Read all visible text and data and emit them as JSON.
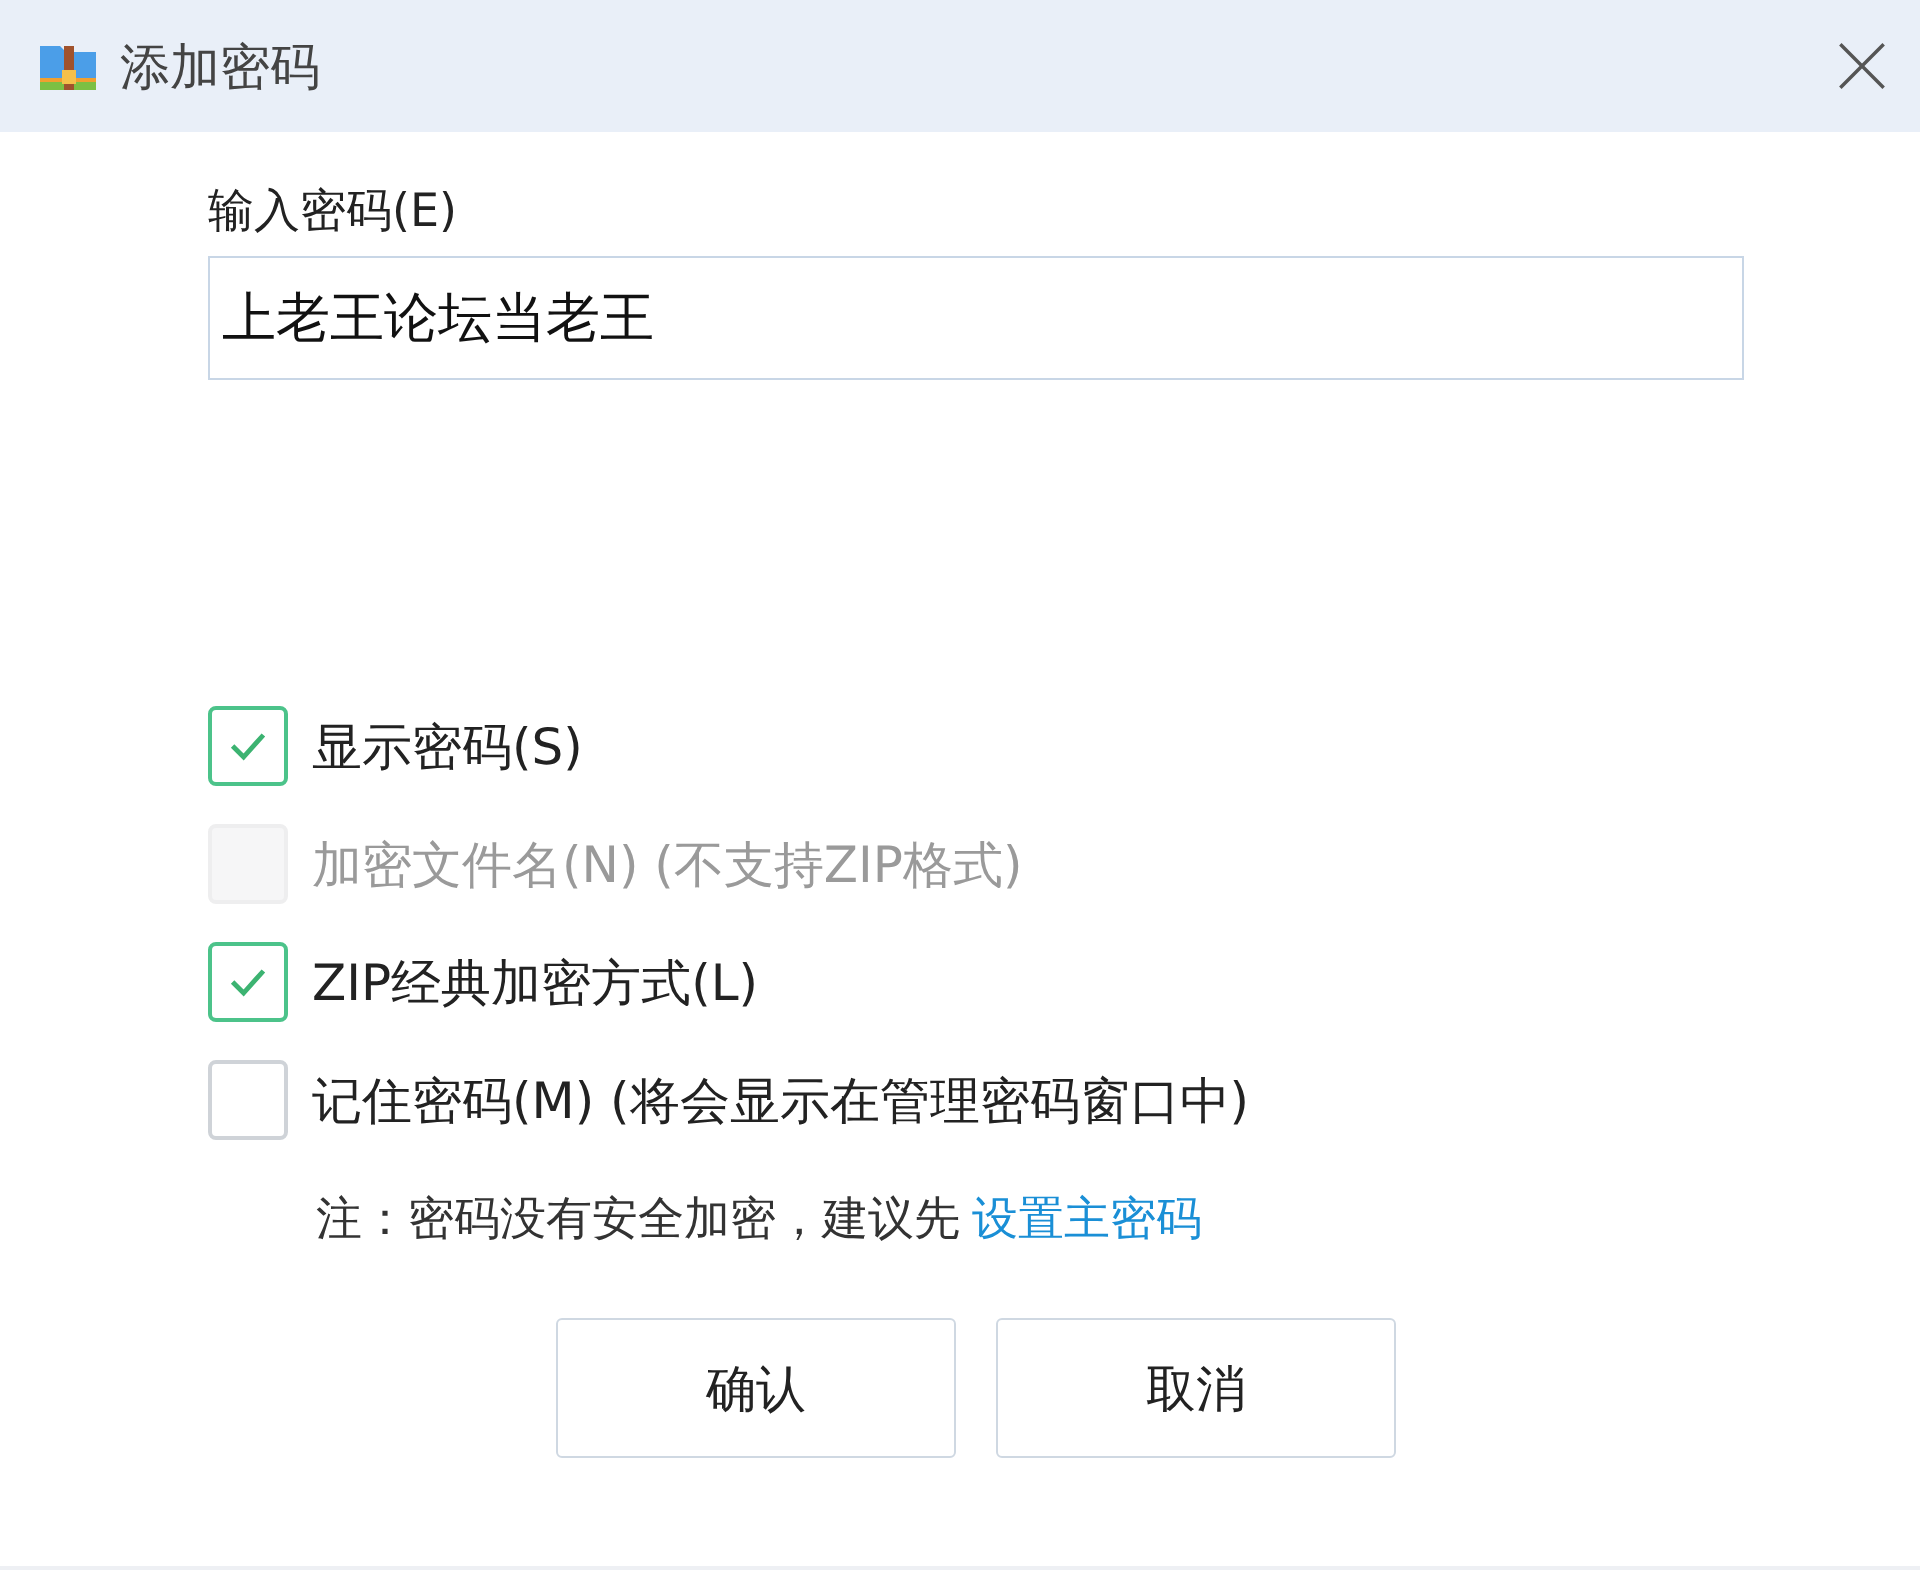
{
  "window": {
    "title": "添加密码"
  },
  "password": {
    "label": "输入密码(E)",
    "value": "上老王论坛当老王"
  },
  "options": [
    {
      "label": "显示密码(S)",
      "checked": true,
      "disabled": false
    },
    {
      "label": "加密文件名(N) (不支持ZIP格式)",
      "checked": false,
      "disabled": true
    },
    {
      "label": "ZIP经典加密方式(L)",
      "checked": true,
      "disabled": false
    },
    {
      "label": "记住密码(M) (将会显示在管理密码窗口中)",
      "checked": false,
      "disabled": false
    }
  ],
  "note": {
    "text": "注：密码没有安全加密，建议先",
    "link": "设置主密码"
  },
  "buttons": [
    "确认",
    "取消"
  ]
}
